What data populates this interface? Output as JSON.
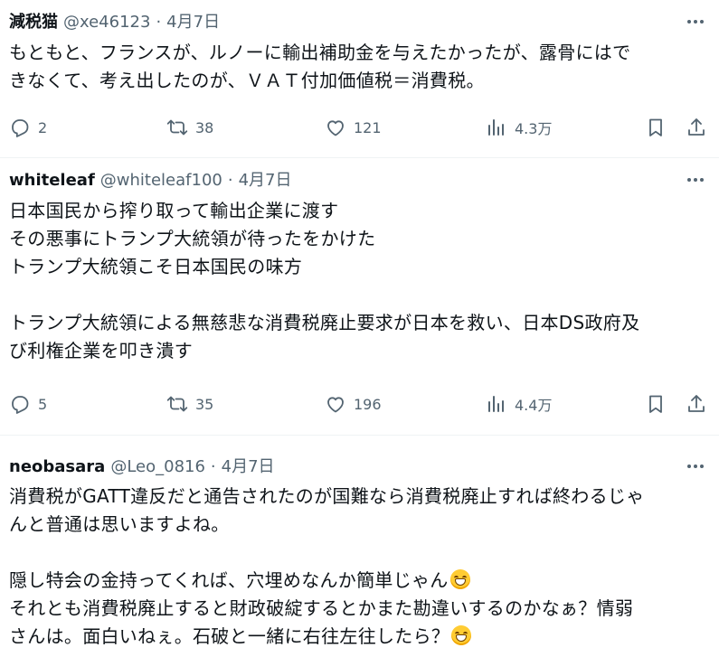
{
  "tweets": [
    {
      "name": "減税猫",
      "handle": "@xe46123",
      "separator": "·",
      "date": "4月7日",
      "lines": [
        "もともと、フランスが、ルノーに輸出補助金を与えたかったが、露骨にはで",
        "きなくて、考え出したのが、ＶＡＴ付加価値税＝消費税。"
      ],
      "replies": "2",
      "retweets": "38",
      "likes": "121",
      "views": "4.3万"
    },
    {
      "name": "whiteleaf",
      "handle": "@whiteleaf100",
      "separator": "·",
      "date": "4月7日",
      "lines": [
        "日本国民から搾り取って輸出企業に渡す",
        "その悪事にトランプ大統領が待ったをかけた",
        "トランプ大統領こそ日本国民の味方",
        "",
        "トランプ大統領による無慈悲な消費税廃止要求が日本を救い、日本DS政府及",
        "び利権企業を叩き潰す"
      ],
      "replies": "5",
      "retweets": "35",
      "likes": "196",
      "views": "4.4万"
    },
    {
      "name": "neobasara",
      "handle": "@Leo_0816",
      "separator": "·",
      "date": "4月7日",
      "lines": [
        "消費税がGATT違反だと通告されたのが国難なら消費税廃止すれば終わるじゃ",
        "んと普通は思いますよね。",
        "",
        "隠し特会の金持ってくれば、穴埋めなんか簡単じゃん",
        "それとも消費税廃止すると財政破綻するとかまた勘違いするのかなぁ？情弱",
        "さんは。面白いねぇ。石破と一緒に右往左往したら？"
      ],
      "emoji_after_lines": [
        3,
        5
      ],
      "emoji_name": "grinning-face-emoji"
    }
  ],
  "icons": {
    "reply": "reply-icon",
    "retweet": "retweet-icon",
    "like": "heart-icon",
    "views": "views-chart-icon",
    "bookmark": "bookmark-icon",
    "share": "share-icon",
    "more": "more-dots-icon"
  },
  "colors": {
    "text": "#0f1419",
    "secondary": "#536471",
    "divider": "#eff3f4",
    "background": "#ffffff"
  }
}
